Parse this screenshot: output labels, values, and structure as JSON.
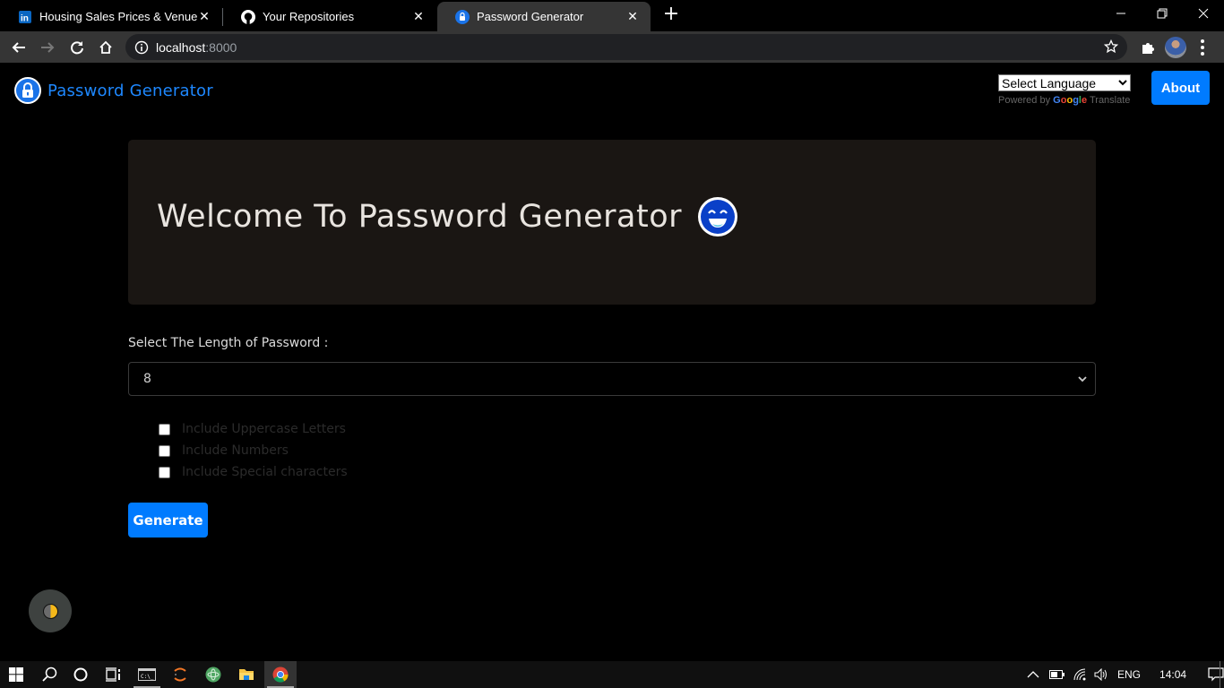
{
  "browser": {
    "tabs": [
      {
        "title": "Housing Sales Prices & Venues D",
        "icon": "linkedin-icon",
        "active": false
      },
      {
        "title": "Your Repositories",
        "icon": "github-icon",
        "active": false
      },
      {
        "title": "Password Generator",
        "icon": "lock-icon",
        "active": true
      }
    ],
    "close_glyph": "✕",
    "new_tab_glyph": "+",
    "url_host": "localhost",
    "url_port": ":8000"
  },
  "navbar": {
    "brand": "Password Generator",
    "translate": {
      "select_label": "Select Language",
      "powered_by": "Powered by",
      "google": [
        "G",
        "o",
        "o",
        "g",
        "l",
        "e"
      ],
      "translate_word": "Translate"
    },
    "about_label": "About"
  },
  "hero": {
    "title": "Welcome To Password Generator",
    "emoji": "grinning-face-icon"
  },
  "form": {
    "length_label": "Select The Length of Password :",
    "length_value": "8",
    "options": [
      {
        "label": "Include Uppercase Letters",
        "checked": false
      },
      {
        "label": "Include Numbers",
        "checked": false
      },
      {
        "label": "Include Special characters",
        "checked": false
      }
    ],
    "generate_label": "Generate"
  },
  "colors": {
    "accent": "#007bff",
    "brand_text": "#1e88ff",
    "hero_bg": "#1a1613"
  },
  "taskbar": {
    "language": "ENG",
    "time": "14:04"
  }
}
